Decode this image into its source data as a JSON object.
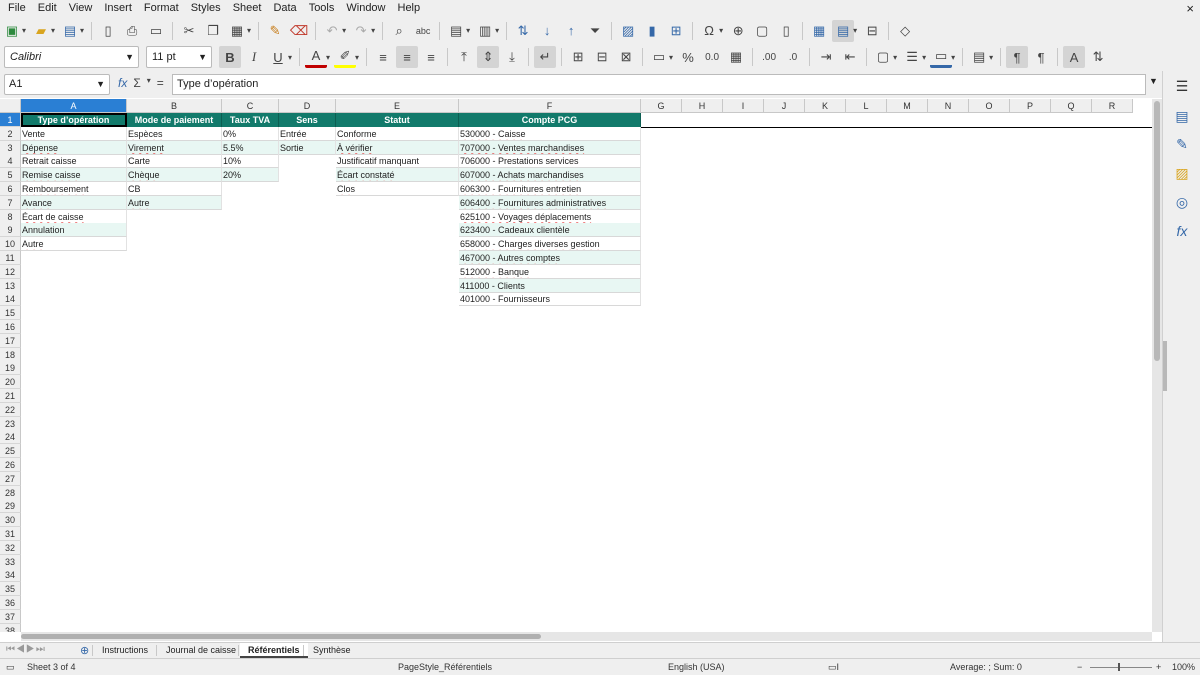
{
  "menu": [
    "File",
    "Edit",
    "View",
    "Insert",
    "Format",
    "Styles",
    "Sheet",
    "Data",
    "Tools",
    "Window",
    "Help"
  ],
  "window_close": "×",
  "format_bar": {
    "font_name": "Calibri",
    "font_size": "11 pt"
  },
  "formula_bar": {
    "cell_ref": "A1",
    "formula": "Type d’opération",
    "fx": "fx",
    "sum": "Σ",
    "equals": "="
  },
  "columns": [
    "A",
    "B",
    "C",
    "D",
    "E",
    "F",
    "G",
    "H",
    "I",
    "J",
    "K",
    "L",
    "M",
    "N",
    "O",
    "P",
    "Q",
    "R"
  ],
  "rows": [
    "1",
    "2",
    "3",
    "4",
    "5",
    "6",
    "7",
    "8",
    "9",
    "10",
    "11",
    "12",
    "13",
    "14",
    "15",
    "16",
    "17",
    "18",
    "19",
    "20",
    "21",
    "22",
    "23",
    "24",
    "25",
    "26",
    "27",
    "28",
    "29",
    "30",
    "31",
    "32",
    "33",
    "34",
    "35",
    "36",
    "37",
    "38"
  ],
  "table": {
    "headers": [
      "Type d’opération",
      "Mode de paiement",
      "Taux TVA",
      "Sens",
      "Statut",
      "Compte PCG"
    ],
    "col_a": [
      "Vente",
      "Dépense",
      "Retrait caisse",
      "Remise caisse",
      "Remboursement",
      "Avance",
      "Écart de caisse",
      "Annulation",
      "Autre"
    ],
    "col_b": [
      "Espèces",
      "Virement",
      "Carte",
      "Chèque",
      "CB",
      "Autre"
    ],
    "col_c": [
      "0%",
      "5.5%",
      "10%",
      "20%"
    ],
    "col_d": [
      "Entrée",
      "Sortie"
    ],
    "col_e": [
      "Conforme",
      "À vérifier",
      "Justificatif manquant",
      "Écart constaté",
      "Clos"
    ],
    "col_f": [
      "530000 - Caisse",
      "707000 - Ventes marchandises",
      "706000 - Prestations services",
      "607000 - Achats marchandises",
      "606300 - Fournitures entretien",
      "606400 - Fournitures administratives",
      "625100 - Voyages déplacements",
      "623400 - Cadeaux clientèle",
      "658000 - Charges diverses gestion",
      "467000 - Autres comptes",
      "512000 - Banque",
      "411000 - Clients",
      "401000 - Fournisseurs"
    ]
  },
  "sheet_tabs": [
    "Instructions",
    "Journal de caisse",
    "Référentiels",
    "Synthèse"
  ],
  "active_tab": "Référentiels",
  "tab_nav": "⏮◀▶⏭",
  "add_tab": "⊕",
  "status": {
    "sheet": "Sheet 3 of 4",
    "page_style": "PageStyle_Référentiels",
    "language": "English (USA)",
    "sum": "Average: ; Sum: 0",
    "zoom": "100%",
    "zoom_minus": "−",
    "zoom_plus": "+"
  },
  "colors": {
    "header_bg": "#127a6b",
    "alt_row": "#e8f7f3",
    "selection": "#2a7fd4"
  }
}
